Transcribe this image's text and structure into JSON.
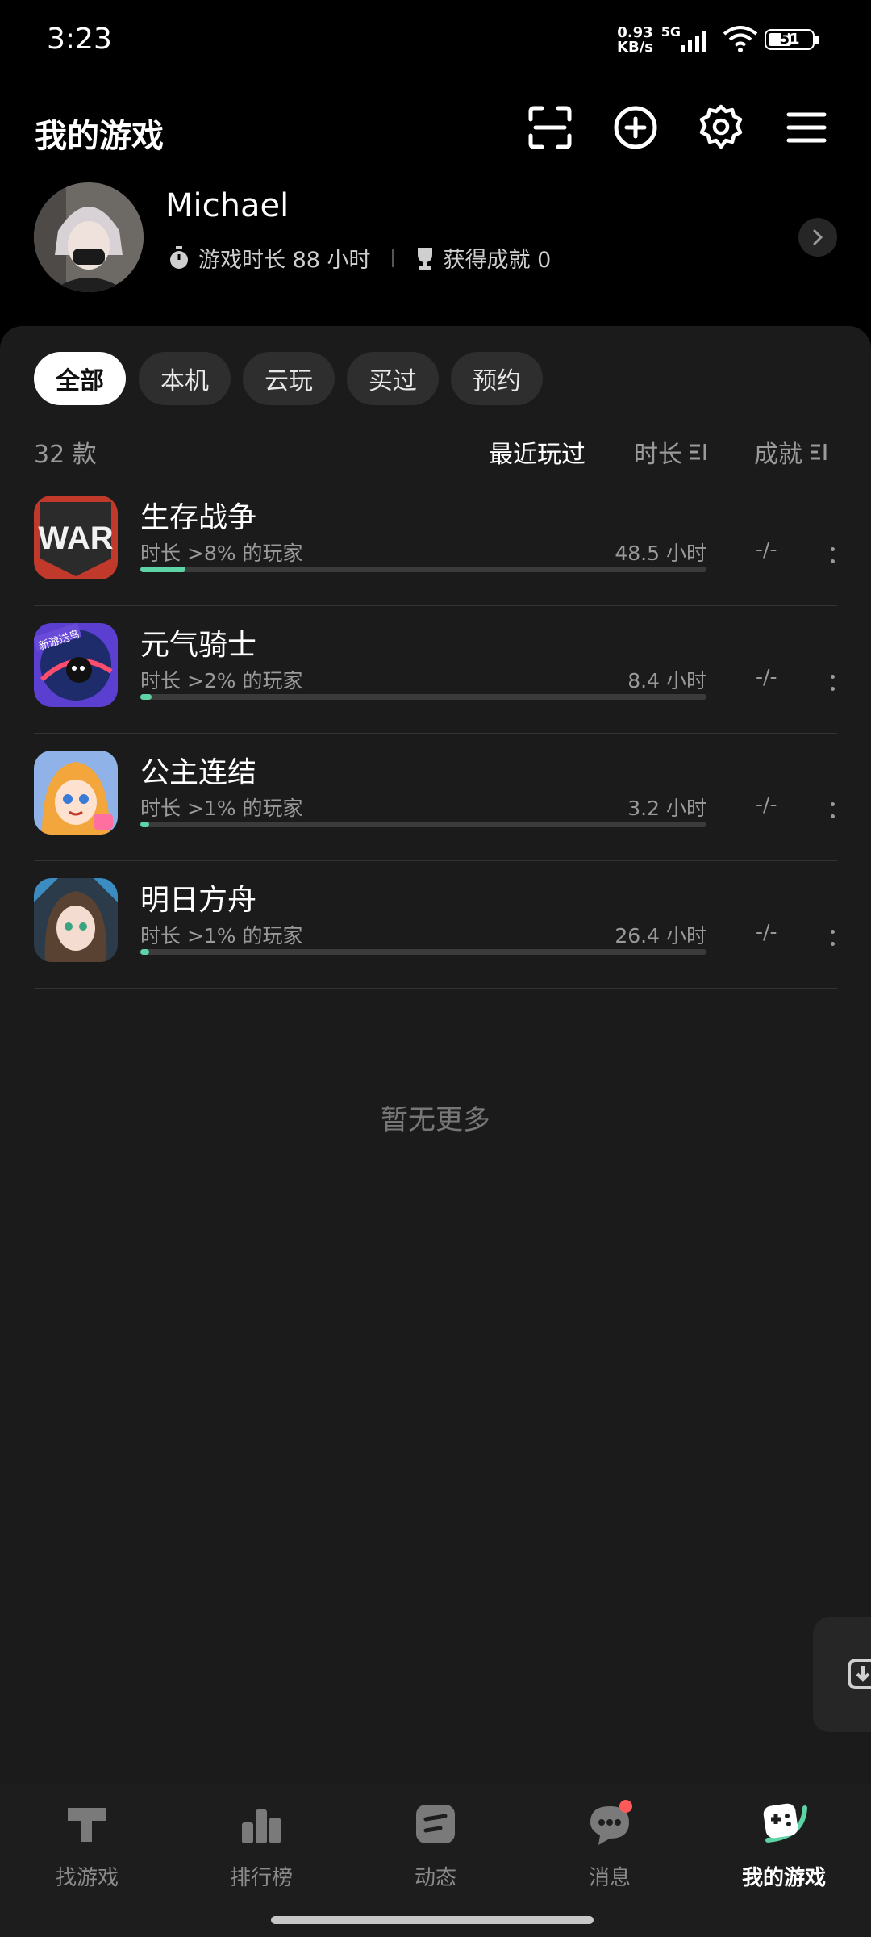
{
  "status_bar": {
    "time": "3:23",
    "net_speed_top": "0.93",
    "net_speed_unit": "KB/s",
    "net_type": "5G",
    "battery": "51"
  },
  "header": {
    "title": "我的游戏",
    "icons": [
      "scan-icon",
      "add-circle-icon",
      "gear-icon",
      "menu-icon"
    ]
  },
  "profile": {
    "name": "Michael",
    "play_time": "游戏时长 88 小时",
    "achievements": "获得成就 0"
  },
  "filters": {
    "tabs": [
      "全部",
      "本机",
      "云玩",
      "买过",
      "预约"
    ],
    "active": "全部"
  },
  "list_header": {
    "count": "32 款",
    "sort_recent": "最近玩过",
    "sort_duration": "时长",
    "sort_achievement": "成就"
  },
  "games": [
    {
      "name": "生存战争",
      "subtitle": "时长 >8% 的玩家",
      "hours": "48.5 小时",
      "achievement": "-/-",
      "progress": 0.08,
      "icon_text": "WAR"
    },
    {
      "name": "元气骑士",
      "subtitle": "时长 >2% 的玩家",
      "hours": "8.4 小时",
      "achievement": "-/-",
      "progress": 0.02,
      "icon_text": "新游送鸟"
    },
    {
      "name": "公主连结",
      "subtitle": "时长 >1% 的玩家",
      "hours": "3.2 小时",
      "achievement": "-/-",
      "progress": 0.01
    },
    {
      "name": "明日方舟",
      "subtitle": "时长 >1% 的玩家",
      "hours": "26.4 小时",
      "achievement": "-/-",
      "progress": 0.01
    }
  ],
  "empty_text": "暂无更多",
  "bottom_nav": {
    "items": [
      {
        "label": "找游戏",
        "icon": "hammer-icon"
      },
      {
        "label": "排行榜",
        "icon": "ranking-icon"
      },
      {
        "label": "动态",
        "icon": "feed-icon"
      },
      {
        "label": "消息",
        "icon": "message-icon"
      },
      {
        "label": "我的游戏",
        "icon": "gamepad-icon"
      }
    ],
    "active": "我的游戏"
  },
  "colors": {
    "accent": "#5ed3a6",
    "badge": "#ff5a5a",
    "panel": "#1b1b1b"
  }
}
